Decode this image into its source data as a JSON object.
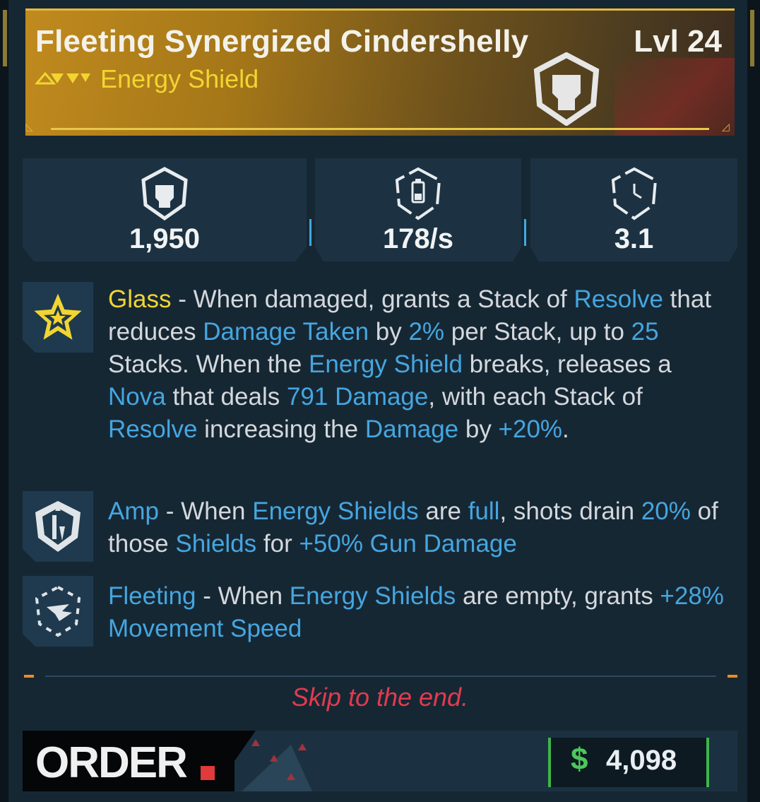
{
  "header": {
    "item_name": "Fleeting Synergized Cindershelly",
    "level": "Lvl 24",
    "item_type": "Energy Shield",
    "rarity_icon": "rarity-chevrons-icon",
    "type_icon": "shield-emblem-icon"
  },
  "stats": [
    {
      "icon": "shield-capacity-icon",
      "value": "1,950"
    },
    {
      "icon": "shield-recharge-rate-icon",
      "value": "178/s"
    },
    {
      "icon": "shield-recharge-delay-icon",
      "value": "3.1"
    }
  ],
  "perks": [
    {
      "icon": "star-perk-icon",
      "segments": [
        {
          "text": "Glass",
          "style": "name-gold"
        },
        {
          "text": " - When damaged, grants a Stack of ",
          "style": "plain"
        },
        {
          "text": "Resolve",
          "style": "hl"
        },
        {
          "text": " that reduces ",
          "style": "plain"
        },
        {
          "text": "Damage Taken",
          "style": "hl"
        },
        {
          "text": " by ",
          "style": "plain"
        },
        {
          "text": "2%",
          "style": "hl"
        },
        {
          "text": " per Stack, up to ",
          "style": "plain"
        },
        {
          "text": "25",
          "style": "hl"
        },
        {
          "text": " Stacks. When the ",
          "style": "plain"
        },
        {
          "text": "Energy Shield",
          "style": "hl"
        },
        {
          "text": " breaks, releases a ",
          "style": "plain"
        },
        {
          "text": "Nova",
          "style": "hl"
        },
        {
          "text": " that deals ",
          "style": "plain"
        },
        {
          "text": "791 Damage",
          "style": "hl"
        },
        {
          "text": ", with each Stack of ",
          "style": "plain"
        },
        {
          "text": "Resolve",
          "style": "hl"
        },
        {
          "text": " increasing the ",
          "style": "plain"
        },
        {
          "text": "Damage",
          "style": "hl"
        },
        {
          "text": " by ",
          "style": "plain"
        },
        {
          "text": "+20%",
          "style": "hl"
        },
        {
          "text": ".",
          "style": "plain"
        }
      ]
    },
    {
      "icon": "amp-perk-icon",
      "segments": [
        {
          "text": "Amp",
          "style": "hl"
        },
        {
          "text": " - When ",
          "style": "plain"
        },
        {
          "text": "Energy Shields",
          "style": "hl"
        },
        {
          "text": " are ",
          "style": "plain"
        },
        {
          "text": "full",
          "style": "hl"
        },
        {
          "text": ", shots drain ",
          "style": "plain"
        },
        {
          "text": "20%",
          "style": "hl"
        },
        {
          "text": " of those ",
          "style": "plain"
        },
        {
          "text": "Shields",
          "style": "hl"
        },
        {
          "text": " for ",
          "style": "plain"
        },
        {
          "text": "+50% Gun Damage",
          "style": "hl"
        }
      ]
    },
    {
      "icon": "fleeting-perk-icon",
      "segments": [
        {
          "text": "Fleeting",
          "style": "hl"
        },
        {
          "text": " - When ",
          "style": "plain"
        },
        {
          "text": "Energy Shields",
          "style": "hl"
        },
        {
          "text": " are empty, grants ",
          "style": "plain"
        },
        {
          "text": "+28% Movement Speed",
          "style": "hl"
        }
      ]
    }
  ],
  "flavor_text": "Skip to the end.",
  "footer": {
    "manufacturer": "ORDER",
    "currency_symbol": "$",
    "price": "4,098"
  },
  "colors": {
    "rarity_gold": "#f2d531",
    "highlight_blue": "#45a6df",
    "flavor_red": "#e23b4e",
    "price_green": "#4cc85a"
  }
}
